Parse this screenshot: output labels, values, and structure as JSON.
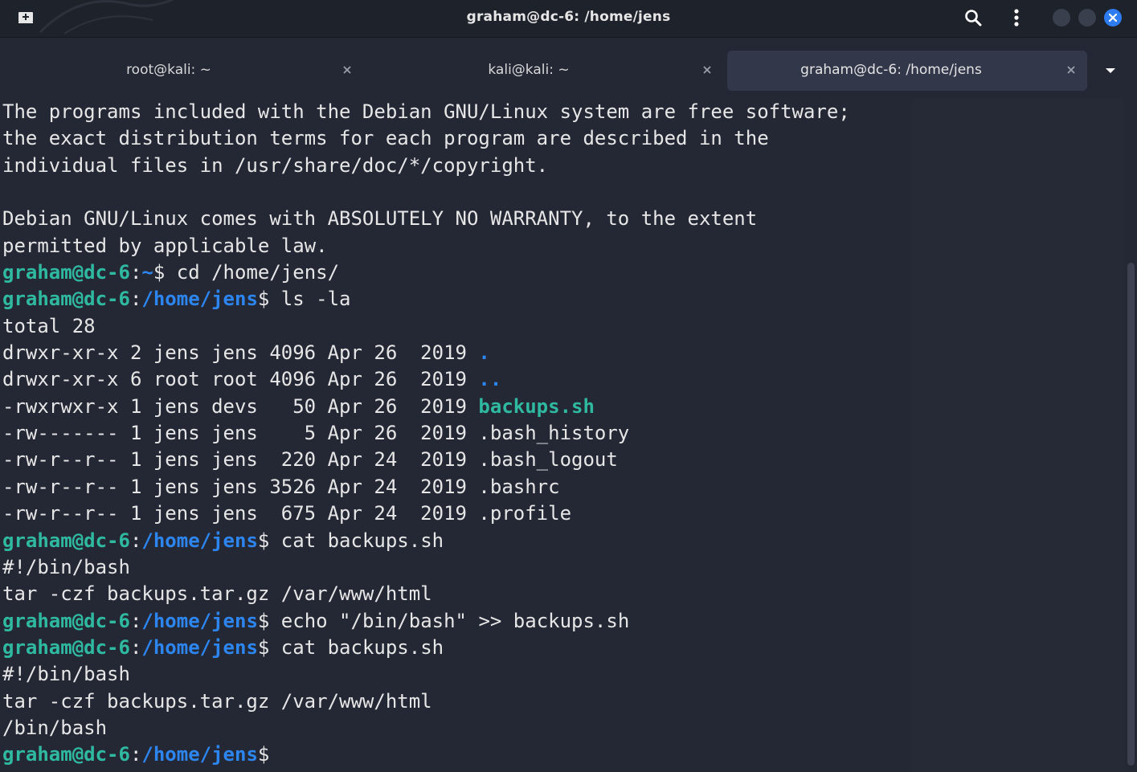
{
  "window": {
    "title": "graham@dc-6: /home/jens"
  },
  "tabs": [
    {
      "label": "root@kali: ~",
      "active": false
    },
    {
      "label": "kali@kali: ~",
      "active": false
    },
    {
      "label": "graham@dc-6: /home/jens",
      "active": true
    }
  ],
  "icons": {
    "new_tab": "new-tab-icon",
    "search": "search-icon",
    "menu": "kebab-menu-icon",
    "close": "close-icon",
    "dropdown": "chevron-down-icon"
  },
  "colors": {
    "background": "#242835",
    "titlebar": "#1e222b",
    "active_tab": "#32374a",
    "prompt_user": "#2fb9a0",
    "prompt_path": "#2d86f0",
    "text": "#e6e6e6",
    "close_button": "#2d7cf2"
  },
  "terminal": {
    "lines": [
      [
        {
          "t": "The programs included with the Debian GNU/Linux system are free software;"
        }
      ],
      [
        {
          "t": "the exact distribution terms for each program are described in the"
        }
      ],
      [
        {
          "t": "individual files in /usr/share/doc/*/copyright."
        }
      ],
      [
        {
          "t": ""
        }
      ],
      [
        {
          "t": "Debian GNU/Linux comes with ABSOLUTELY NO WARRANTY, to the extent"
        }
      ],
      [
        {
          "t": "permitted by applicable law."
        }
      ],
      [
        {
          "t": "graham@dc-6",
          "c": "user"
        },
        {
          "t": ":"
        },
        {
          "t": "~",
          "c": "path"
        },
        {
          "t": "$ cd /home/jens/"
        }
      ],
      [
        {
          "t": "graham@dc-6",
          "c": "user"
        },
        {
          "t": ":"
        },
        {
          "t": "/home/jens",
          "c": "path"
        },
        {
          "t": "$ ls -la"
        }
      ],
      [
        {
          "t": "total 28"
        }
      ],
      [
        {
          "t": "drwxr-xr-x 2 jens jens 4096 Apr 26  2019 "
        },
        {
          "t": ".",
          "c": "dir"
        }
      ],
      [
        {
          "t": "drwxr-xr-x 6 root root 4096 Apr 26  2019 "
        },
        {
          "t": "..",
          "c": "dir"
        }
      ],
      [
        {
          "t": "-rwxrwxr-x 1 jens devs   50 Apr 26  2019 "
        },
        {
          "t": "backups.sh",
          "c": "exec"
        }
      ],
      [
        {
          "t": "-rw------- 1 jens jens    5 Apr 26  2019 .bash_history"
        }
      ],
      [
        {
          "t": "-rw-r--r-- 1 jens jens  220 Apr 24  2019 .bash_logout"
        }
      ],
      [
        {
          "t": "-rw-r--r-- 1 jens jens 3526 Apr 24  2019 .bashrc"
        }
      ],
      [
        {
          "t": "-rw-r--r-- 1 jens jens  675 Apr 24  2019 .profile"
        }
      ],
      [
        {
          "t": "graham@dc-6",
          "c": "user"
        },
        {
          "t": ":"
        },
        {
          "t": "/home/jens",
          "c": "path"
        },
        {
          "t": "$ cat backups.sh"
        }
      ],
      [
        {
          "t": "#!/bin/bash"
        }
      ],
      [
        {
          "t": "tar -czf backups.tar.gz /var/www/html"
        }
      ],
      [
        {
          "t": "graham@dc-6",
          "c": "user"
        },
        {
          "t": ":"
        },
        {
          "t": "/home/jens",
          "c": "path"
        },
        {
          "t": "$ echo \"/bin/bash\" >> backups.sh"
        }
      ],
      [
        {
          "t": "graham@dc-6",
          "c": "user"
        },
        {
          "t": ":"
        },
        {
          "t": "/home/jens",
          "c": "path"
        },
        {
          "t": "$ cat backups.sh"
        }
      ],
      [
        {
          "t": "#!/bin/bash"
        }
      ],
      [
        {
          "t": "tar -czf backups.tar.gz /var/www/html"
        }
      ],
      [
        {
          "t": "/bin/bash"
        }
      ],
      [
        {
          "t": "graham@dc-6",
          "c": "user"
        },
        {
          "t": ":"
        },
        {
          "t": "/home/jens",
          "c": "path"
        },
        {
          "t": "$"
        }
      ]
    ]
  }
}
